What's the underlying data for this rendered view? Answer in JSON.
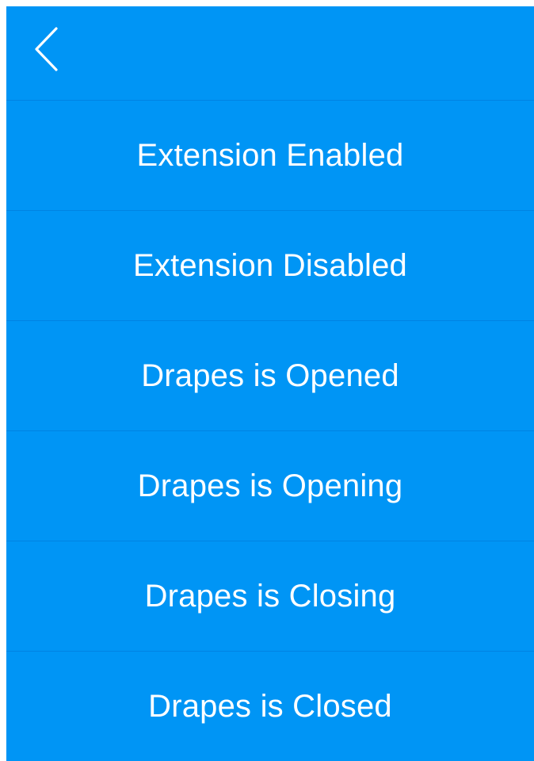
{
  "header": {
    "back_icon": "chevron-left-icon"
  },
  "menu": {
    "items": [
      {
        "label": "Extension Enabled"
      },
      {
        "label": "Extension Disabled"
      },
      {
        "label": "Drapes is Opened"
      },
      {
        "label": "Drapes is Opening"
      },
      {
        "label": "Drapes is Closing"
      },
      {
        "label": "Drapes is Closed"
      }
    ]
  },
  "colors": {
    "background": "#0095f5",
    "text": "#ffffff",
    "divider": "#0b6fc0"
  }
}
